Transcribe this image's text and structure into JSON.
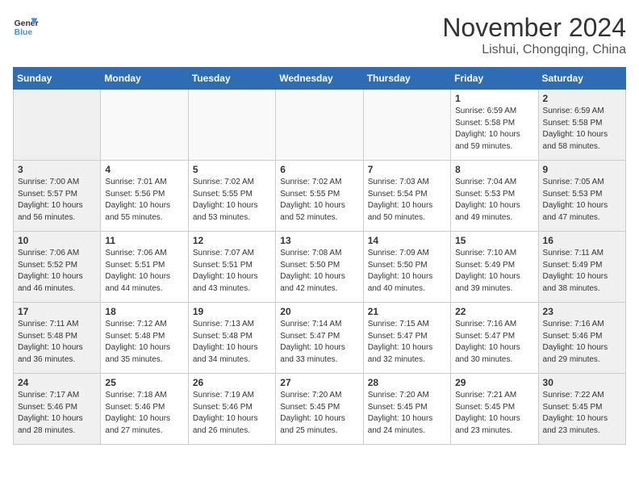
{
  "logo": {
    "line1": "General",
    "line2": "Blue"
  },
  "title": "November 2024",
  "location": "Lishui, Chongqing, China",
  "weekdays": [
    "Sunday",
    "Monday",
    "Tuesday",
    "Wednesday",
    "Thursday",
    "Friday",
    "Saturday"
  ],
  "weeks": [
    [
      {
        "day": "",
        "info": ""
      },
      {
        "day": "",
        "info": ""
      },
      {
        "day": "",
        "info": ""
      },
      {
        "day": "",
        "info": ""
      },
      {
        "day": "",
        "info": ""
      },
      {
        "day": "1",
        "info": "Sunrise: 6:59 AM\nSunset: 5:58 PM\nDaylight: 10 hours\nand 59 minutes."
      },
      {
        "day": "2",
        "info": "Sunrise: 6:59 AM\nSunset: 5:58 PM\nDaylight: 10 hours\nand 58 minutes."
      }
    ],
    [
      {
        "day": "3",
        "info": "Sunrise: 7:00 AM\nSunset: 5:57 PM\nDaylight: 10 hours\nand 56 minutes."
      },
      {
        "day": "4",
        "info": "Sunrise: 7:01 AM\nSunset: 5:56 PM\nDaylight: 10 hours\nand 55 minutes."
      },
      {
        "day": "5",
        "info": "Sunrise: 7:02 AM\nSunset: 5:55 PM\nDaylight: 10 hours\nand 53 minutes."
      },
      {
        "day": "6",
        "info": "Sunrise: 7:02 AM\nSunset: 5:55 PM\nDaylight: 10 hours\nand 52 minutes."
      },
      {
        "day": "7",
        "info": "Sunrise: 7:03 AM\nSunset: 5:54 PM\nDaylight: 10 hours\nand 50 minutes."
      },
      {
        "day": "8",
        "info": "Sunrise: 7:04 AM\nSunset: 5:53 PM\nDaylight: 10 hours\nand 49 minutes."
      },
      {
        "day": "9",
        "info": "Sunrise: 7:05 AM\nSunset: 5:53 PM\nDaylight: 10 hours\nand 47 minutes."
      }
    ],
    [
      {
        "day": "10",
        "info": "Sunrise: 7:06 AM\nSunset: 5:52 PM\nDaylight: 10 hours\nand 46 minutes."
      },
      {
        "day": "11",
        "info": "Sunrise: 7:06 AM\nSunset: 5:51 PM\nDaylight: 10 hours\nand 44 minutes."
      },
      {
        "day": "12",
        "info": "Sunrise: 7:07 AM\nSunset: 5:51 PM\nDaylight: 10 hours\nand 43 minutes."
      },
      {
        "day": "13",
        "info": "Sunrise: 7:08 AM\nSunset: 5:50 PM\nDaylight: 10 hours\nand 42 minutes."
      },
      {
        "day": "14",
        "info": "Sunrise: 7:09 AM\nSunset: 5:50 PM\nDaylight: 10 hours\nand 40 minutes."
      },
      {
        "day": "15",
        "info": "Sunrise: 7:10 AM\nSunset: 5:49 PM\nDaylight: 10 hours\nand 39 minutes."
      },
      {
        "day": "16",
        "info": "Sunrise: 7:11 AM\nSunset: 5:49 PM\nDaylight: 10 hours\nand 38 minutes."
      }
    ],
    [
      {
        "day": "17",
        "info": "Sunrise: 7:11 AM\nSunset: 5:48 PM\nDaylight: 10 hours\nand 36 minutes."
      },
      {
        "day": "18",
        "info": "Sunrise: 7:12 AM\nSunset: 5:48 PM\nDaylight: 10 hours\nand 35 minutes."
      },
      {
        "day": "19",
        "info": "Sunrise: 7:13 AM\nSunset: 5:48 PM\nDaylight: 10 hours\nand 34 minutes."
      },
      {
        "day": "20",
        "info": "Sunrise: 7:14 AM\nSunset: 5:47 PM\nDaylight: 10 hours\nand 33 minutes."
      },
      {
        "day": "21",
        "info": "Sunrise: 7:15 AM\nSunset: 5:47 PM\nDaylight: 10 hours\nand 32 minutes."
      },
      {
        "day": "22",
        "info": "Sunrise: 7:16 AM\nSunset: 5:47 PM\nDaylight: 10 hours\nand 30 minutes."
      },
      {
        "day": "23",
        "info": "Sunrise: 7:16 AM\nSunset: 5:46 PM\nDaylight: 10 hours\nand 29 minutes."
      }
    ],
    [
      {
        "day": "24",
        "info": "Sunrise: 7:17 AM\nSunset: 5:46 PM\nDaylight: 10 hours\nand 28 minutes."
      },
      {
        "day": "25",
        "info": "Sunrise: 7:18 AM\nSunset: 5:46 PM\nDaylight: 10 hours\nand 27 minutes."
      },
      {
        "day": "26",
        "info": "Sunrise: 7:19 AM\nSunset: 5:46 PM\nDaylight: 10 hours\nand 26 minutes."
      },
      {
        "day": "27",
        "info": "Sunrise: 7:20 AM\nSunset: 5:45 PM\nDaylight: 10 hours\nand 25 minutes."
      },
      {
        "day": "28",
        "info": "Sunrise: 7:20 AM\nSunset: 5:45 PM\nDaylight: 10 hours\nand 24 minutes."
      },
      {
        "day": "29",
        "info": "Sunrise: 7:21 AM\nSunset: 5:45 PM\nDaylight: 10 hours\nand 23 minutes."
      },
      {
        "day": "30",
        "info": "Sunrise: 7:22 AM\nSunset: 5:45 PM\nDaylight: 10 hours\nand 23 minutes."
      }
    ]
  ]
}
